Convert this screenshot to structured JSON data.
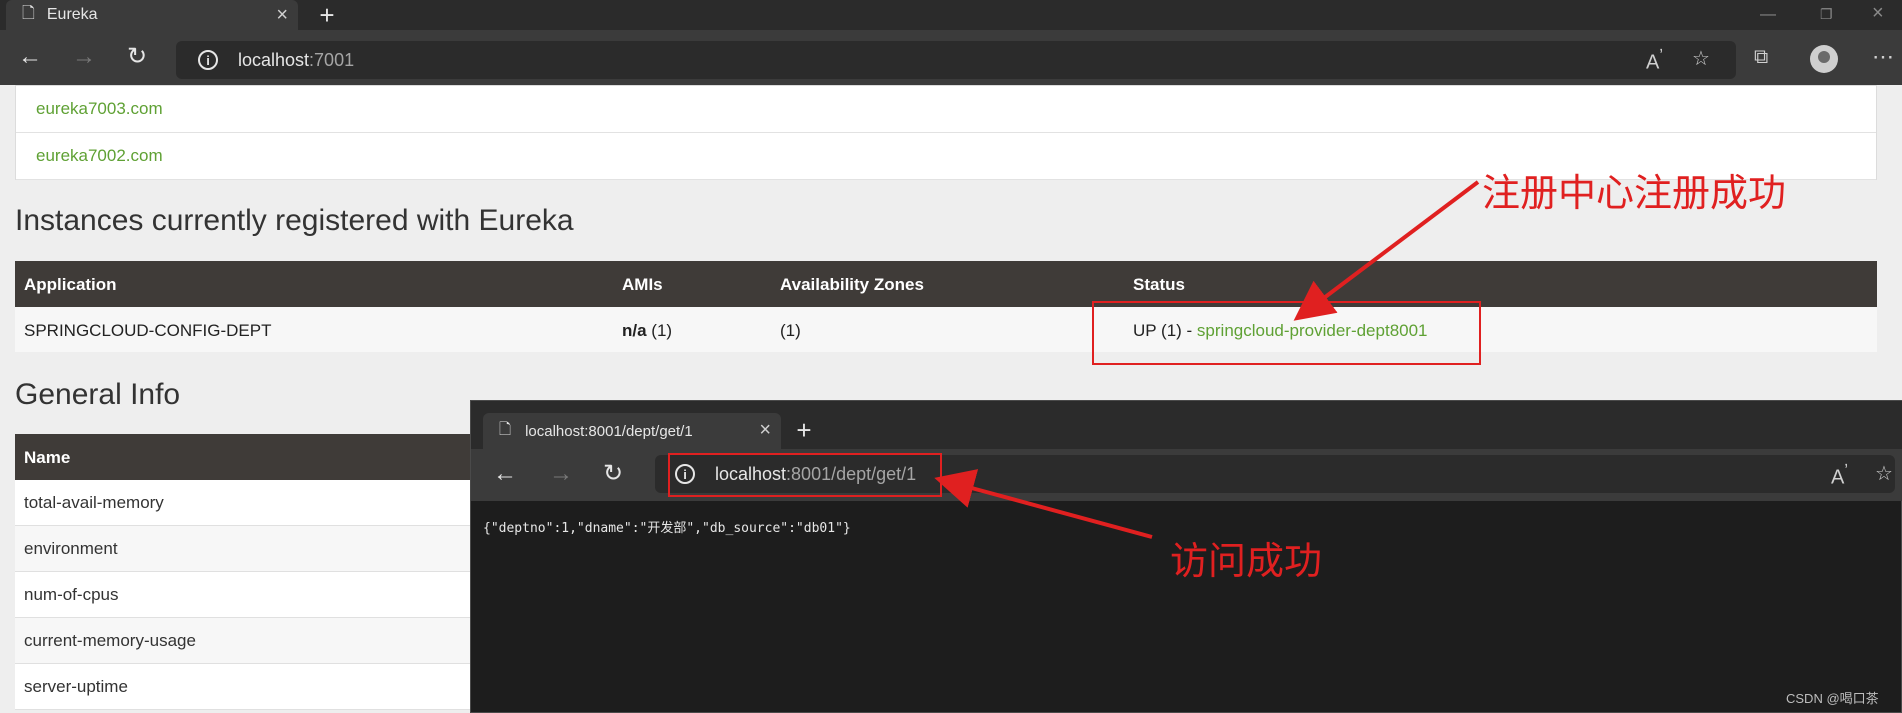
{
  "browser": {
    "tab_title": "Eureka",
    "address_host": "localhost",
    "address_port": ":7001"
  },
  "eureka_list": [
    "eureka7003.com",
    "eureka7002.com"
  ],
  "instances": {
    "heading": "Instances currently registered with Eureka",
    "columns": [
      "Application",
      "AMIs",
      "Availability Zones",
      "Status"
    ],
    "row": {
      "application": "SPRINGCLOUD-CONFIG-DEPT",
      "amis_bold": "n/a",
      "amis_count": " (1)",
      "zones": "(1)",
      "status_prefix": "UP (1) - ",
      "status_link": "springcloud-provider-dept8001"
    }
  },
  "general_info": {
    "heading": "General Info",
    "column": "Name",
    "rows": [
      "total-avail-memory",
      "environment",
      "num-of-cpus",
      "current-memory-usage",
      "server-uptime"
    ]
  },
  "second_window": {
    "tab_title": "localhost:8001/dept/get/1",
    "address_host": "localhost",
    "address_path": ":8001/dept/get/1",
    "body": "{\"deptno\":1,\"dname\":\"开发部\",\"db_source\":\"db01\"}"
  },
  "annotations": {
    "registered": "注册中心注册成功",
    "access_ok": "访问成功"
  },
  "watermark": "CSDN @喝口茶",
  "colors": {
    "link_green": "#5fa134",
    "annotation_red": "#e02020",
    "header_dark": "#3f3b38"
  }
}
